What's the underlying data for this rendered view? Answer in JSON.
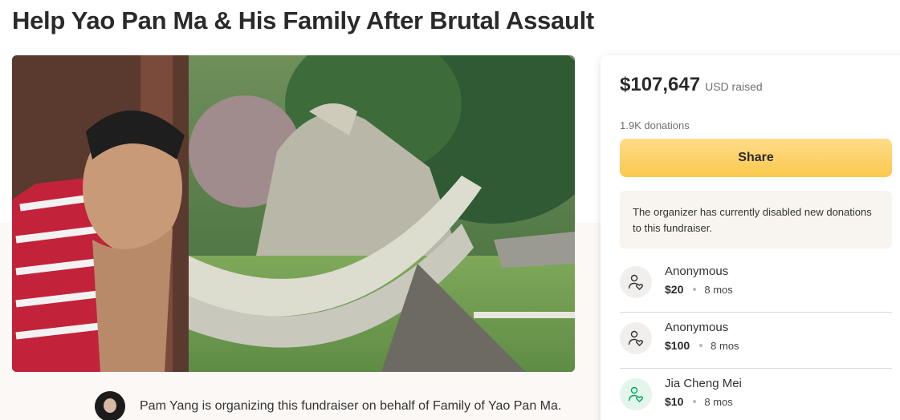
{
  "page": {
    "title": "Help Yao Pan Ma & His Family After Brutal Assault"
  },
  "hero": {
    "alt": "Photo of Yao Pan Ma by a stone bridge"
  },
  "organizer": {
    "text": "Pam Yang is organizing this fundraiser on behalf of Family of Yao Pan Ma."
  },
  "sidebar": {
    "amount": "$107,647",
    "amount_suffix": "USD raised",
    "donations_count": "1.9K donations",
    "share_label": "Share",
    "notice": "The organizer has currently disabled new donations to this fundraiser.",
    "donations": [
      {
        "name": "Anonymous",
        "amount": "$20",
        "time": "8 mos",
        "icon": "donor-heart-icon",
        "icon_color": "#333333"
      },
      {
        "name": "Anonymous",
        "amount": "$100",
        "time": "8 mos",
        "icon": "donor-heart-icon",
        "icon_color": "#333333"
      },
      {
        "name": "Jia Cheng Mei",
        "amount": "$10",
        "time": "8 mos",
        "icon": "donor-heart-icon",
        "icon_color": "#02a95c"
      }
    ]
  },
  "colors": {
    "share_button": "#fbc84c",
    "notice_bg": "#f8f4ef",
    "green_accent": "#02a95c"
  }
}
